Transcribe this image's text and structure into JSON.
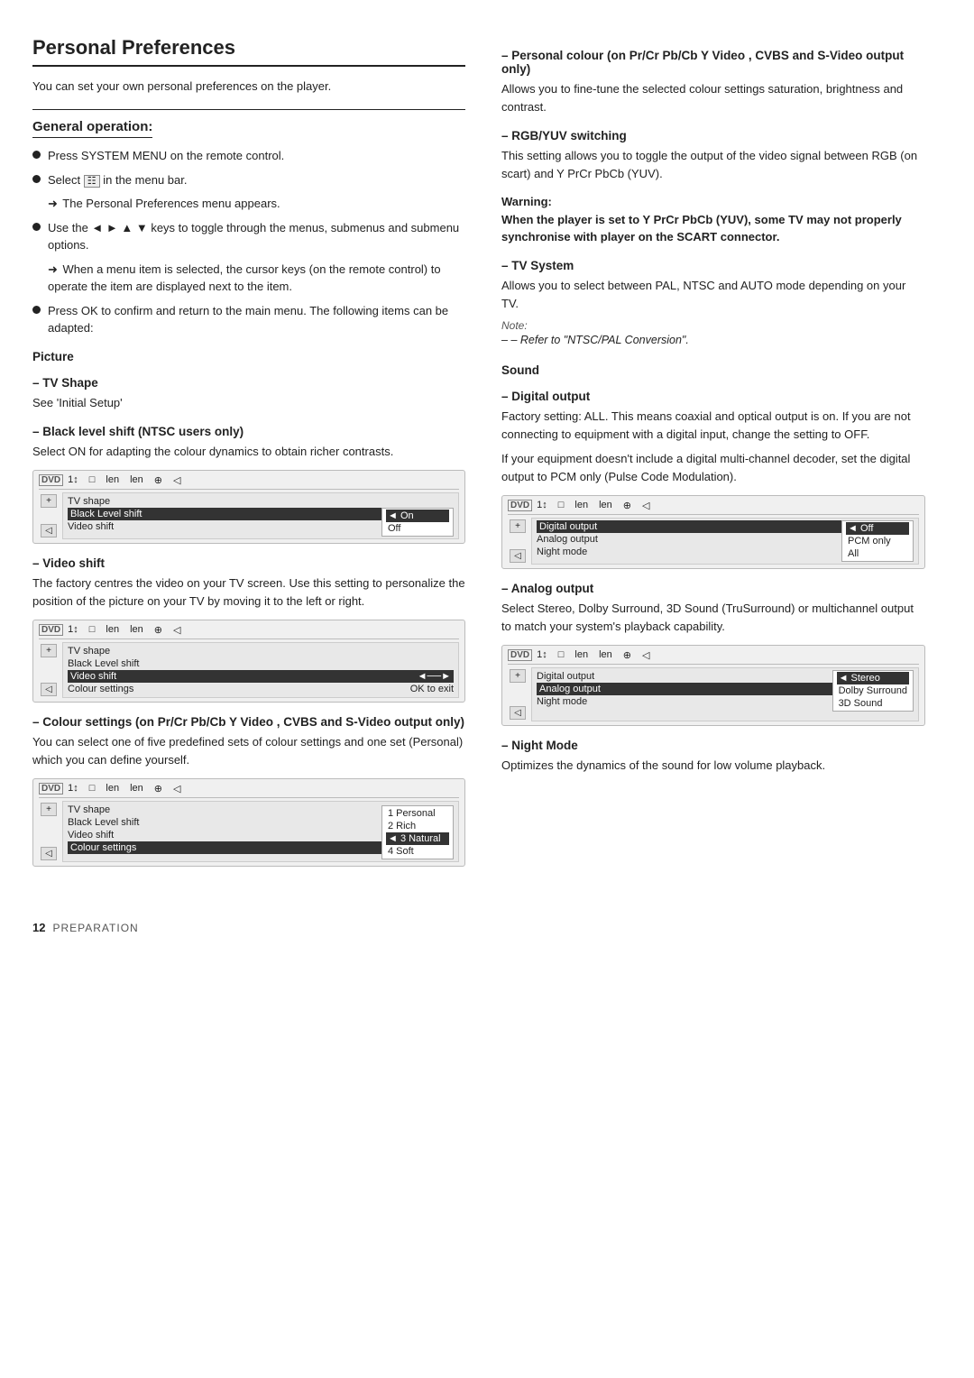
{
  "page": {
    "title": "Personal Preferences",
    "intro": "You can set your own personal preferences on the player.",
    "footer_number": "12",
    "footer_section": "Preparation"
  },
  "general_operation": {
    "title": "General operation:",
    "bullets": [
      "Press SYSTEM MENU on the remote control.",
      "Select  in the menu bar.",
      "The Personal Preferences menu appears.",
      "Use the ◄ ► ▲ ▼ keys to toggle through the menus, submenus and submenu options.",
      "When a menu item is selected, the cursor keys (on the remote control) to operate the item are displayed next to the item.",
      "Press OK to confirm and return to the main menu. The following items can be adapted:"
    ],
    "arrow_items": [
      "The Personal Preferences menu appears.",
      "When a menu item is selected, the cursor keys (on the remote control) to operate the item are displayed next to the item."
    ]
  },
  "picture": {
    "title": "Picture",
    "tv_shape": {
      "title": "–  TV Shape",
      "text": "See 'Initial Setup'"
    },
    "black_level": {
      "title": "–  Black level shift (NTSC users only)",
      "text": "Select ON for adapting the colour dynamics to obtain richer contrasts.",
      "ui": {
        "top_bar": [
          "1↕",
          "□",
          "len",
          "len",
          "⊕",
          "◁"
        ],
        "dvd_label": "DVD",
        "rows": [
          {
            "label": "TV shape",
            "value": "",
            "selected": false
          },
          {
            "label": "Black Level shift",
            "value": "◄ On",
            "selected": true
          },
          {
            "label": "Video shift",
            "value": "Off",
            "selected": false
          }
        ]
      }
    },
    "video_shift": {
      "title": "–  Video shift",
      "text": "The factory centres the video on your TV screen. Use this setting to personalize the position of the picture on your TV by moving it to the left or right.",
      "ui": {
        "rows": [
          {
            "label": "TV shape",
            "value": "",
            "selected": false
          },
          {
            "label": "Black Level shift",
            "value": "",
            "selected": false
          },
          {
            "label": "Video shift",
            "value": "◄──►",
            "selected": true
          },
          {
            "label": "Colour settings",
            "value": "OK to exit",
            "selected": false
          }
        ]
      }
    },
    "colour_settings": {
      "title": "–  Colour settings  (on Pr/Cr Pb/Cb Y Video , CVBS and S-Video output only)",
      "text": "You can select one of five predefined sets of colour settings and one set (Personal) which you can define yourself.",
      "ui": {
        "rows": [
          {
            "label": "TV shape",
            "value": "",
            "selected": false
          },
          {
            "label": "Black Level shift",
            "value": "",
            "selected": false
          },
          {
            "label": "Video shift",
            "value": "",
            "selected": false
          },
          {
            "label": "Colour settings",
            "value": "",
            "selected": true
          }
        ],
        "dropdown": [
          {
            "label": "1 Personal",
            "selected": false
          },
          {
            "label": "2 Rich",
            "selected": false
          },
          {
            "label": "3 Natural",
            "selected": true
          },
          {
            "label": "4 Soft",
            "selected": false
          }
        ]
      }
    }
  },
  "right": {
    "personal_colour": {
      "title": "–  Personal colour  (on Pr/Cr Pb/Cb Y Video , CVBS and S-Video output only)",
      "text": "Allows you to fine-tune the selected colour settings saturation, brightness and contrast."
    },
    "rgb_yuv": {
      "title": "–  RGB/YUV switching",
      "text": "This setting allows you to toggle the output of the video signal between RGB (on scart) and Y PrCr PbCb (YUV)."
    },
    "warning": {
      "title": "Warning:",
      "text": "When the player is set to Y PrCr PbCb (YUV), some TV may not properly synchronise with player on the SCART connector."
    },
    "tv_system": {
      "title": "–  TV System",
      "text": "Allows you to select between PAL, NTSC and AUTO mode depending on your TV.",
      "note_label": "Note:",
      "note_text": "–  Refer to \"NTSC/PAL Conversion\"."
    },
    "sound": {
      "title": "Sound",
      "digital_output": {
        "title": "–  Digital output",
        "text1": "Factory setting: ALL. This means coaxial and optical output is on. If you are not connecting to equipment with a digital input, change the setting to OFF.",
        "text2": "If your equipment doesn't include a digital multi-channel decoder, set the digital output to PCM only (Pulse Code Modulation).",
        "ui": {
          "rows": [
            {
              "label": "Digital output",
              "value": "◄ Off",
              "selected": true
            },
            {
              "label": "Analog output",
              "value": "PCM only",
              "selected": false
            },
            {
              "label": "Night mode",
              "value": "All",
              "selected": false
            }
          ]
        }
      },
      "analog_output": {
        "title": "–  Analog output",
        "text": "Select Stereo, Dolby Surround, 3D Sound (TruSurround) or multichannel output to match your system's playback capability.",
        "ui": {
          "rows": [
            {
              "label": "Digital output",
              "value": "",
              "selected": false
            },
            {
              "label": "Analog output",
              "value": "",
              "selected": true
            },
            {
              "label": "Night mode",
              "value": "",
              "selected": false
            }
          ],
          "dropdown": [
            {
              "label": "◄ Stereo",
              "selected": true
            },
            {
              "label": "Dolby Surround",
              "selected": false
            },
            {
              "label": "3D Sound",
              "selected": false
            }
          ]
        }
      },
      "night_mode": {
        "title": "–  Night Mode",
        "text": "Optimizes the dynamics of the sound for low volume playback."
      }
    }
  }
}
